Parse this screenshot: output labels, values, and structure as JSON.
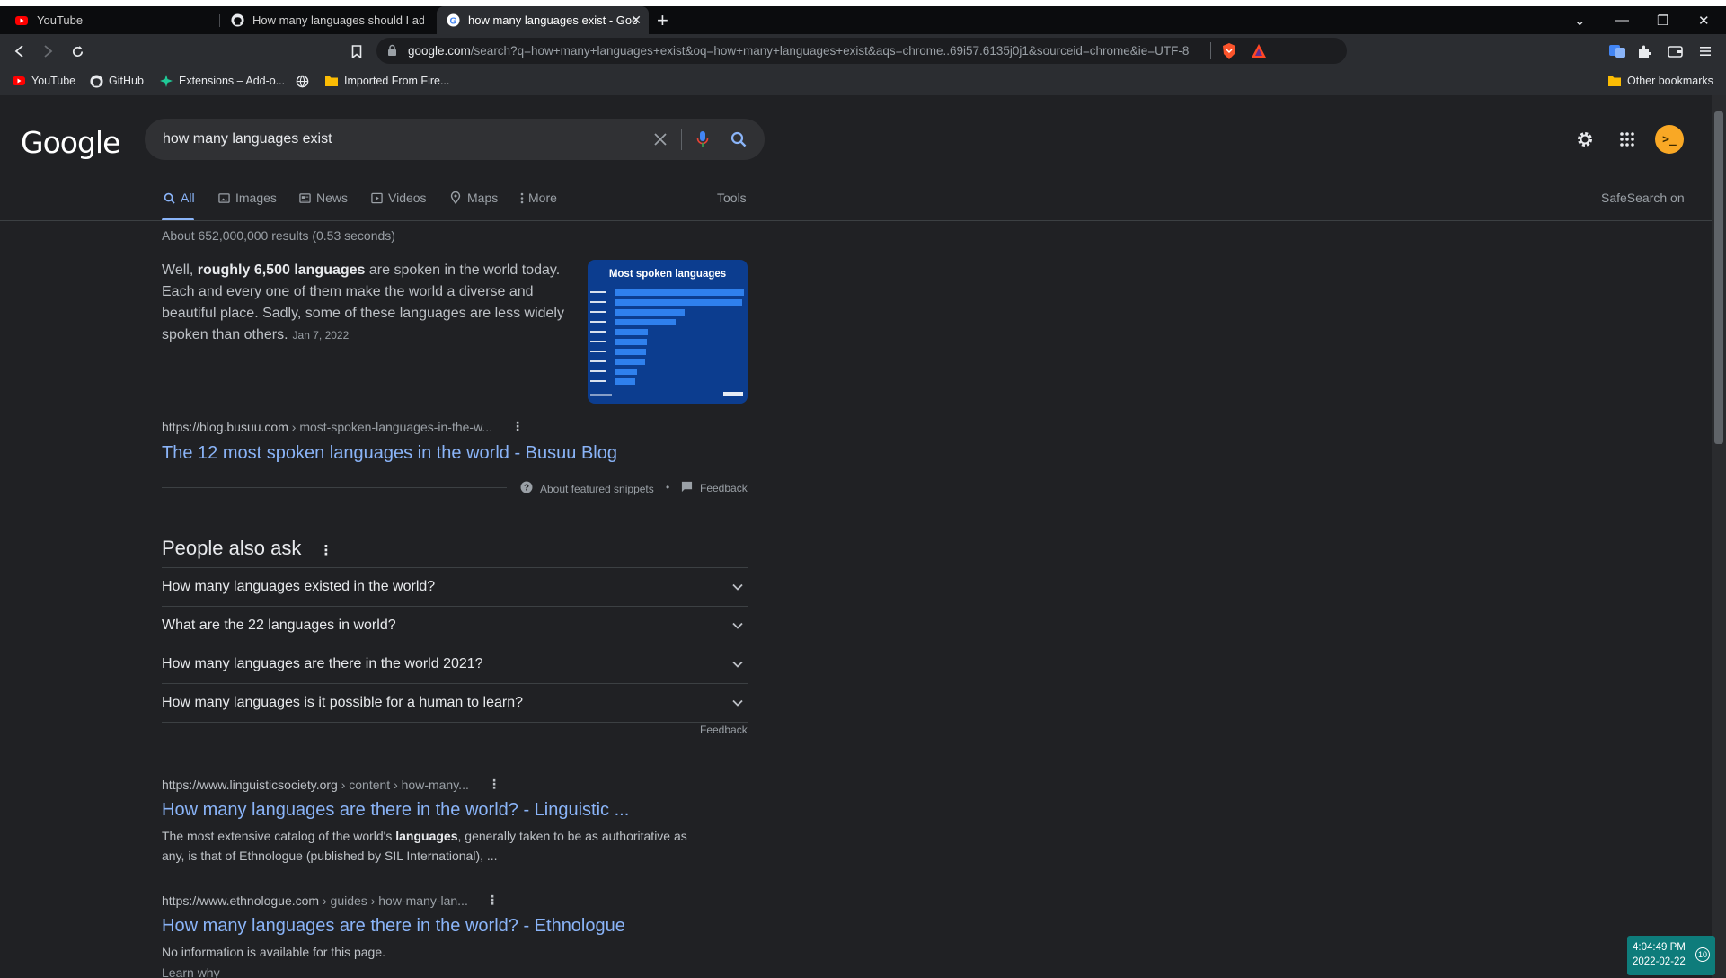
{
  "browser": {
    "tabs": [
      {
        "label": "YouTube",
        "icon": "youtube-icon"
      },
      {
        "label": "How many languages should I add? · I",
        "icon": "github-icon"
      },
      {
        "label": "how many languages exist - Goog",
        "icon": "google-icon",
        "active": true
      }
    ],
    "address": {
      "host": "google.com",
      "path": "/search?q=how+many+languages+exist&oq=how+many+languages+exist&aqs=chrome..69i57.6135j0j1&sourceid=chrome&ie=UTF-8"
    },
    "bookmarks": [
      {
        "label": "YouTube",
        "icon": "youtube-icon"
      },
      {
        "label": "GitHub",
        "icon": "github-icon"
      },
      {
        "label": "Extensions – Add-o...",
        "icon": "extensions-icon"
      },
      {
        "label": "",
        "icon": "globe-icon"
      },
      {
        "label": "Imported From Fire...",
        "icon": "folder-icon"
      }
    ],
    "other_bookmarks": "Other bookmarks"
  },
  "google": {
    "logo": "Google",
    "query": "how many languages exist",
    "nav_tabs": [
      "All",
      "Images",
      "News",
      "Videos",
      "Maps",
      "More"
    ],
    "tools": "Tools",
    "safesearch": "SafeSearch on",
    "avatar_text": ">_",
    "stats": "About 652,000,000 results (0.53 seconds)"
  },
  "featured": {
    "text_pre": "Well, ",
    "text_bold": "roughly 6,500 languages",
    "text_post": " are spoken in the world today. Each and every one of them make the world a diverse and beautiful place. Sadly, some of these languages are less widely spoken than others.",
    "date": "Jan 7, 2022",
    "image_title": "Most spoken languages",
    "url_host": "https://blog.busuu.com",
    "url_path": " › most-spoken-languages-in-the-w...",
    "title": "The 12 most spoken languages in the world - Busuu Blog",
    "about": "About featured snippets",
    "bullet": "•",
    "feedback": "Feedback"
  },
  "paa": {
    "heading": "People also ask",
    "questions": [
      "How many languages existed in the world?",
      "What are the 22 languages in world?",
      "How many languages are there in the world 2021?",
      "How many languages is it possible for a human to learn?"
    ],
    "feedback": "Feedback"
  },
  "results": [
    {
      "url_host": "https://www.linguisticsociety.org",
      "url_path": " › content › how-many...",
      "title": "How many languages are there in the world? - Linguistic ...",
      "desc_1": "The most extensive catalog of the world's ",
      "desc_bold": "languages",
      "desc_2": ", generally taken to be as authoritative as any, is that of Ethnologue (published by SIL International), ..."
    },
    {
      "url_host": "https://www.ethnologue.com",
      "url_path": " › guides › how-many-lan...",
      "title": "How many languages are there in the world? - Ethnologue",
      "desc": "No information is available for this page.",
      "learn_why": "Learn why"
    }
  ],
  "taskbar": {
    "time": "4:04:49 PM",
    "date": "2022-02-22",
    "badge": "10"
  },
  "colors": {
    "background": "#202124",
    "link": "#8ab4f8",
    "tabbar": "#0b0c0e",
    "toolbar": "#2b2d31",
    "clock_bg": "#0e7c7b"
  }
}
